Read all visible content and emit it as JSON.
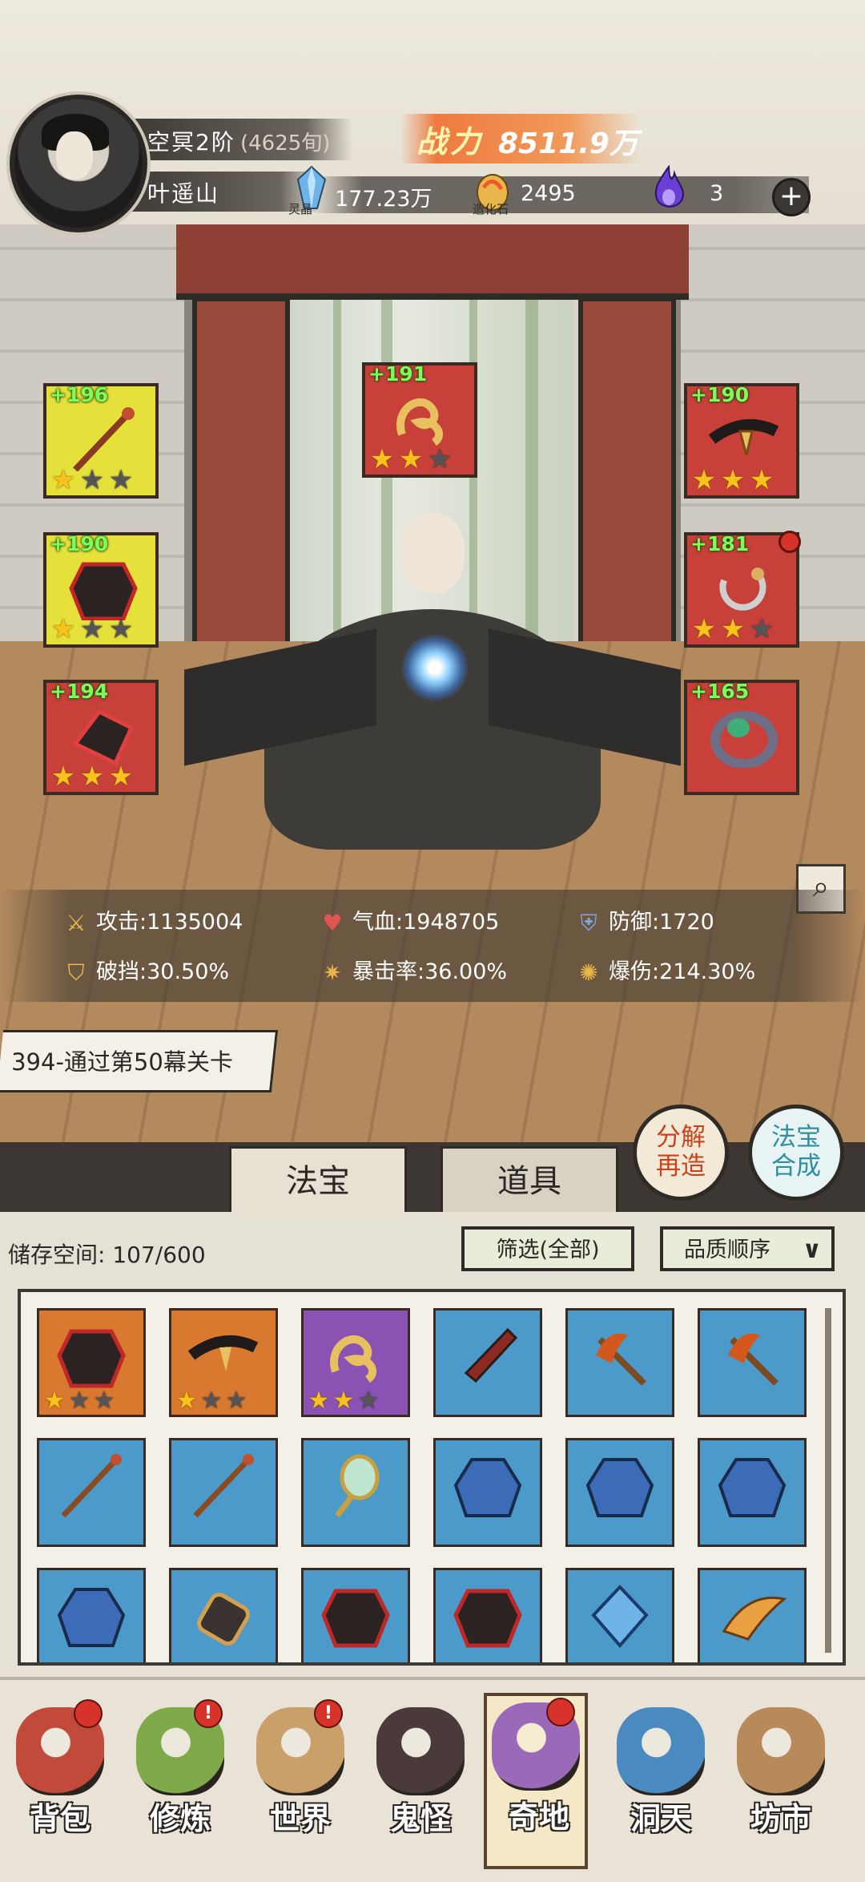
{
  "header": {
    "realm": "空冥2阶",
    "realm_age": "(4625旬)",
    "player_name": "叶遥山",
    "power_label": "战力",
    "power_value": "8511.9万",
    "resources": [
      {
        "label": "灵晶",
        "value": "177.23万",
        "icon": "blue-crystal-icon"
      },
      {
        "label": "造化石",
        "value": "2495",
        "icon": "golden-stone-icon"
      },
      {
        "label": "",
        "value": "3",
        "icon": "purple-flame-icon"
      }
    ],
    "add_label": "+"
  },
  "equipment": {
    "top": {
      "level": "+191",
      "stars": 2,
      "max_stars": 3
    },
    "left": [
      {
        "level": "+196",
        "stars": 1,
        "max_stars": 3
      },
      {
        "level": "+190",
        "stars": 1,
        "max_stars": 3
      },
      {
        "level": "+194",
        "stars": 3,
        "max_stars": 3
      }
    ],
    "right": [
      {
        "level": "+190",
        "stars": 3,
        "max_stars": 3
      },
      {
        "level": "+181",
        "stars": 2,
        "max_stars": 3
      },
      {
        "level": "+165",
        "stars": 0,
        "max_stars": 0
      }
    ]
  },
  "stats": {
    "attack": "攻击:1135004",
    "hp": "气血:1948705",
    "defense": "防御:1720",
    "break": "破挡:30.50%",
    "crit_rate": "暴击率:36.00%",
    "crit_dmg": "爆伤:214.30%"
  },
  "quest": "394-通过第50幕关卡",
  "tabs": {
    "treasure": "法宝",
    "items": "道具"
  },
  "actions": {
    "dismantle": [
      "分解",
      "再造"
    ],
    "synth": [
      "法宝",
      "合成"
    ]
  },
  "storage": {
    "capacity": "储存空间: 107/600",
    "filter": "筛选(全部)",
    "sort": "品质顺序"
  },
  "inventory": [
    {
      "color": "orange",
      "stars": 1,
      "icon": "armor-icon"
    },
    {
      "color": "orange",
      "stars": 1,
      "icon": "belt-icon"
    },
    {
      "color": "purple",
      "stars": 2,
      "icon": "gold-ornament-icon"
    },
    {
      "color": "blue",
      "stars": 0,
      "icon": "dagger-icon"
    },
    {
      "color": "blue",
      "stars": 0,
      "icon": "axe-icon"
    },
    {
      "color": "blue",
      "stars": 0,
      "icon": "axe-icon"
    },
    {
      "color": "blue",
      "stars": 0,
      "icon": "staff-icon"
    },
    {
      "color": "blue",
      "stars": 0,
      "icon": "staff-icon"
    },
    {
      "color": "blue",
      "stars": 0,
      "icon": "mirror-icon"
    },
    {
      "color": "blue",
      "stars": 0,
      "icon": "robe-icon"
    },
    {
      "color": "blue",
      "stars": 0,
      "icon": "robe-icon"
    },
    {
      "color": "blue",
      "stars": 0,
      "icon": "robe-icon"
    },
    {
      "color": "blue",
      "stars": 0,
      "icon": "robe-icon"
    },
    {
      "color": "blue",
      "stars": 0,
      "icon": "bracer-icon"
    },
    {
      "color": "blue",
      "stars": 0,
      "icon": "armor-icon"
    },
    {
      "color": "blue",
      "stars": 0,
      "icon": "armor-icon"
    },
    {
      "color": "blue",
      "stars": 0,
      "icon": "crystal-icon"
    },
    {
      "color": "blue",
      "stars": 0,
      "icon": "wing-icon"
    }
  ],
  "nav": [
    {
      "label": "背包",
      "icon": "bag-icon",
      "badge": "dot"
    },
    {
      "label": "修炼",
      "icon": "lotus-icon",
      "badge": "!"
    },
    {
      "label": "世界",
      "icon": "scroll-map-icon",
      "badge": "!"
    },
    {
      "label": "鬼怪",
      "icon": "demon-egg-icon",
      "badge": ""
    },
    {
      "label": "奇地",
      "icon": "mountain-icon",
      "badge": "dot",
      "active": true
    },
    {
      "label": "洞天",
      "icon": "portal-icon",
      "badge": ""
    },
    {
      "label": "坊市",
      "icon": "market-stall-icon",
      "badge": ""
    }
  ],
  "colors": {
    "slot_yellow": "#e6e03a",
    "slot_red": "#c8403a",
    "rarity_orange": "#d9782f",
    "rarity_purple": "#8a52b3",
    "rarity_blue": "#4b9ac9",
    "power_accent": "#ef7a3f",
    "level_green": "#7bff58"
  }
}
